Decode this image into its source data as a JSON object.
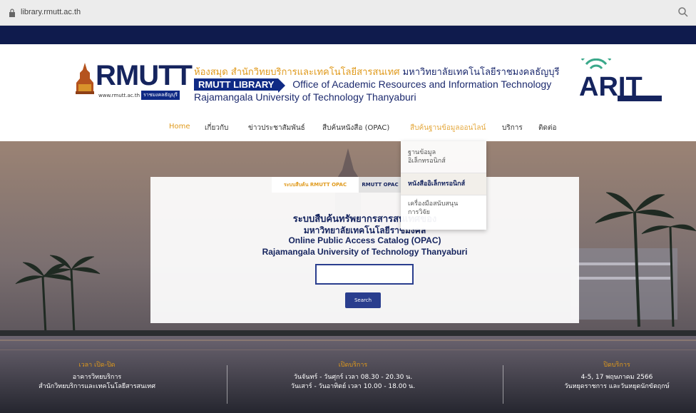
{
  "browser": {
    "url": "library.rmutt.ac.th",
    "icons": [
      "lock-icon",
      "search-icon"
    ]
  },
  "header": {
    "logo_text": "RMUTT",
    "logo_web": "www.rmutt.ac.th",
    "logo_tag": "ราชมงคลธัญบุรี",
    "thai_title_highlight": "ห้องสมุด สำนักวิทยบริการและเทคโนโลยีสารสนเทศ",
    "thai_title_rest": " มหาวิทยาลัยเทคโนโลยีราชมงคลธัญบุรี",
    "badge": "RMUTT LIBRARY",
    "eng_line1": "Office of Academic Resources and Information Technology",
    "eng_line2": "Rajamangala University of Technology Thanyaburi",
    "arit_logo": "ARIT"
  },
  "nav": {
    "items": [
      {
        "label": "Home",
        "active": true
      },
      {
        "label": "เกี่ยวกับ"
      },
      {
        "label": "ข่าวประชาสัมพันธ์"
      },
      {
        "label": "สืบค้นหนังสือ (OPAC)"
      },
      {
        "label": "สืบค้นฐานข้อมูลออนไลน์"
      },
      {
        "label": "บริการ"
      },
      {
        "label": "ติดต่อ"
      }
    ]
  },
  "dropdown": {
    "items": [
      {
        "line1": "ฐานข้อมูล",
        "line2": "อิเล็กทรอนิกส์"
      },
      {
        "line1": "หนังสืออิเล็กทรอนิกส์",
        "selected": true
      },
      {
        "line1": "เครื่องมือสนับสนุน",
        "line2": "การวิจัย"
      }
    ]
  },
  "search": {
    "tab_active": "ระบบสืบค้น RMUTT OPAC",
    "tab_inactive": "RMUTT OPAC",
    "thai_line1": "ระบบสืบค้นทรัพยากรสารสนเทศของ",
    "thai_line2": "มหาวิทยาลัยเทคโนโลยีราชมงคล",
    "eng_line1": "Online Public Access Catalog (OPAC)",
    "eng_line2": "Rajamangala University of Technology Thanyaburi",
    "input_value": "",
    "button_label": "Search"
  },
  "footer": {
    "hours": {
      "heading": "เวลา เปิด-ปิด",
      "line1": "อาคารวิทยบริการ",
      "line2": "สำนักวิทยบริการและเทคโนโลยีสารสนเทศ"
    },
    "open": {
      "heading": "เปิดบริการ",
      "line1": "วันจันทร์ - วันศุกร์ เวลา 08.30 - 20.30 น.",
      "line2": "วันเสาร์ - วันอาทิตย์ เวลา 10.00 - 18.00 น."
    },
    "closed": {
      "heading": "ปิดบริการ",
      "line1": "4-5, 17 พฤษภาคม 2566",
      "line2": "วันหยุดราชการ และวันหยุดนักขัตฤกษ์"
    }
  },
  "colors": {
    "navy": "#0f1b4d",
    "brand_blue": "#15245e",
    "accent_orange": "#e09a1c"
  }
}
